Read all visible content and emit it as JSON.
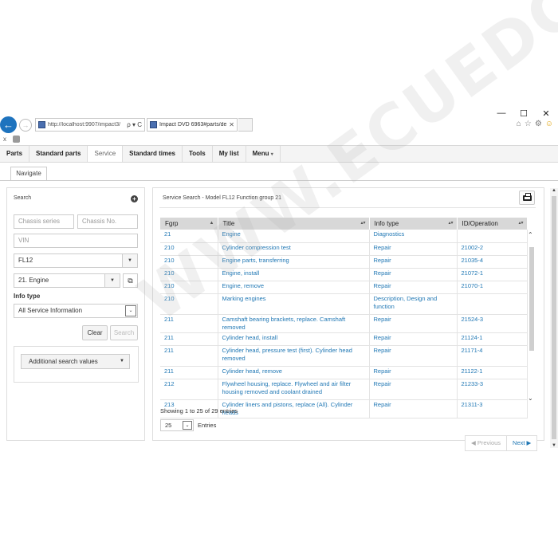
{
  "window_controls": {
    "minimize": "—",
    "maximize": "☐",
    "close": "✕"
  },
  "browser": {
    "address": "http://localhost:9907/impact3/",
    "address_tools": "ρ ▾ C",
    "tab_title": "Impact DVD 6963#parts/det...",
    "tab_close": "✕",
    "fav_close": "x",
    "icons": [
      "home-icon",
      "star-icon",
      "gear-icon",
      "smiley-icon"
    ]
  },
  "nav": {
    "items": [
      {
        "label": "Parts"
      },
      {
        "label": "Standard parts"
      },
      {
        "label": "Service"
      },
      {
        "label": "Standard times"
      },
      {
        "label": "Tools"
      },
      {
        "label": "My list"
      },
      {
        "label": "Menu"
      }
    ],
    "menu_caret": "▾"
  },
  "subtab": {
    "label": "Navigate"
  },
  "search": {
    "title": "Search",
    "chassis_series_placeholder": "Chassis series",
    "chassis_no_placeholder": "Chassis No.",
    "vin_placeholder": "VIN",
    "model_value": "FL12",
    "function_group_value": "21. Engine",
    "info_type_label": "Info type",
    "info_type_value": "All Service Information",
    "clear_label": "Clear",
    "search_label": "Search",
    "additional_label": "Additional search values"
  },
  "results": {
    "title": "Service Search - Model FL12 Function group 21",
    "columns": [
      "Fgrp",
      "Title",
      "Info type",
      "ID/Operation"
    ],
    "rows": [
      {
        "fgrp": "21",
        "title": "Engine",
        "info": "Diagnostics",
        "id": ""
      },
      {
        "fgrp": "210",
        "title": "Cylinder compression test",
        "info": "Repair",
        "id": "21002-2"
      },
      {
        "fgrp": "210",
        "title": "Engine parts, transferring",
        "info": "Repair",
        "id": "21035-4"
      },
      {
        "fgrp": "210",
        "title": "Engine, install",
        "info": "Repair",
        "id": "21072-1"
      },
      {
        "fgrp": "210",
        "title": "Engine, remove",
        "info": "Repair",
        "id": "21070-1"
      },
      {
        "fgrp": "210",
        "title": "Marking engines",
        "info": "Description, Design and function",
        "id": ""
      },
      {
        "fgrp": "211",
        "title": "Camshaft bearing brackets, replace. Camshaft removed",
        "info": "Repair",
        "id": "21524-3"
      },
      {
        "fgrp": "211",
        "title": "Cylinder head, install",
        "info": "Repair",
        "id": "21124-1"
      },
      {
        "fgrp": "211",
        "title": "Cylinder head, pressure test (first). Cylinder head removed",
        "info": "Repair",
        "id": "21171-4"
      },
      {
        "fgrp": "211",
        "title": "Cylinder head, remove",
        "info": "Repair",
        "id": "21122-1"
      },
      {
        "fgrp": "212",
        "title": "Flywheel housing, replace. Flywheel and air filter housing removed and coolant drained",
        "info": "Repair",
        "id": "21233-3"
      },
      {
        "fgrp": "213",
        "title": "Cylinder liners and pistons, replace (All). Cylinder heads",
        "info": "Repair",
        "id": "21311-3"
      }
    ],
    "showing": "Showing 1 to 25 of 29 entries",
    "page_length": "25",
    "entries_label": "Entries"
  },
  "pagination": {
    "previous": "◀ Previous",
    "next": "Next ▶"
  },
  "watermark": "WWW.ECUEDC.COM",
  "colors": {
    "link": "#1f77b4",
    "back_button": "#1e73be",
    "header_bg": "#d8d8d8"
  }
}
